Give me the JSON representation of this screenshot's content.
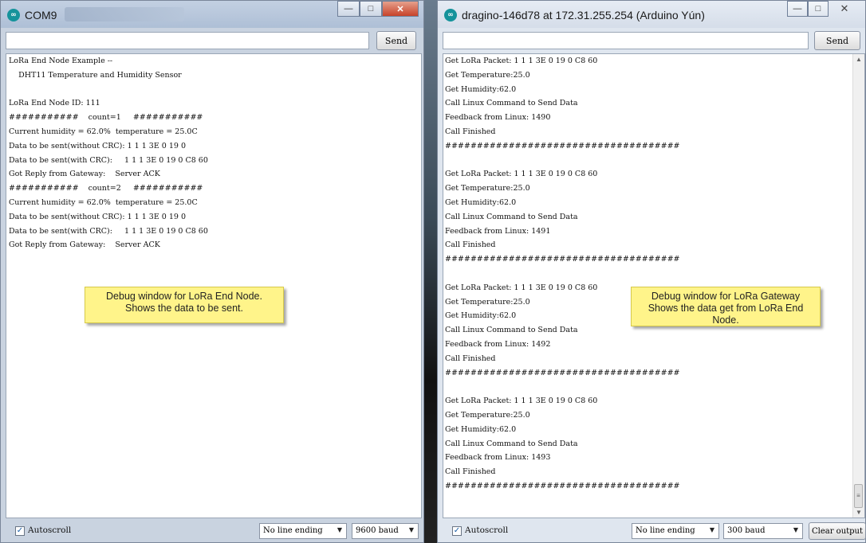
{
  "left_window": {
    "title": "COM9",
    "send_label": "Send",
    "input_value": "",
    "output_lines": [
      "LoRa End Node Example --",
      "    DHT11 Temperature and Humidity Sensor",
      "",
      "LoRa End Node ID: 111",
      "###########    count=1     ###########",
      "Current humidity = 62.0%  temperature = 25.0C",
      "Data to be sent(without CRC): 1 1 1 3E 0 19 0",
      "Data to be sent(with CRC):     1 1 1 3E 0 19 0 C8 60",
      "Got Reply from Gateway:    Server ACK",
      "###########    count=2     ###########",
      "Current humidity = 62.0%  temperature = 25.0C",
      "Data to be sent(without CRC): 1 1 1 3E 0 19 0",
      "Data to be sent(with CRC):     1 1 1 3E 0 19 0 C8 60",
      "Got Reply from Gateway:    Server ACK"
    ],
    "callout": [
      "Debug window for LoRa End Node.",
      "Shows the data to be sent."
    ],
    "autoscroll_label": "Autoscroll",
    "autoscroll_checked": true,
    "line_ending": "No line ending",
    "baud": "9600 baud"
  },
  "right_window": {
    "title": "dragino-146d78 at 172.31.255.254 (Arduino Yún)",
    "send_label": "Send",
    "input_value": "",
    "output_lines": [
      "Get LoRa Packet: 1 1 1 3E 0 19 0 C8 60",
      "Get Temperature:25.0",
      "Get Humidity:62.0",
      "Call Linux Command to Send Data",
      "Feedback from Linux: 1490",
      "Call Finished",
      "#####################################",
      "",
      "Get LoRa Packet: 1 1 1 3E 0 19 0 C8 60",
      "Get Temperature:25.0",
      "Get Humidity:62.0",
      "Call Linux Command to Send Data",
      "Feedback from Linux: 1491",
      "Call Finished",
      "#####################################",
      "",
      "Get LoRa Packet: 1 1 1 3E 0 19 0 C8 60",
      "Get Temperature:25.0",
      "Get Humidity:62.0",
      "Call Linux Command to Send Data",
      "Feedback from Linux: 1492",
      "Call Finished",
      "#####################################",
      "",
      "Get LoRa Packet: 1 1 1 3E 0 19 0 C8 60",
      "Get Temperature:25.0",
      "Get Humidity:62.0",
      "Call Linux Command to Send Data",
      "Feedback from Linux: 1493",
      "Call Finished",
      "#####################################"
    ],
    "callout": [
      "Debug window for LoRa Gateway",
      "Shows the data get from LoRa End",
      "Node."
    ],
    "autoscroll_label": "Autoscroll",
    "autoscroll_checked": true,
    "line_ending": "No line ending",
    "baud": "300 baud",
    "clear_label": "Clear output"
  },
  "icons": {
    "app": "arduino-icon",
    "minimize": "minimize-icon",
    "maximize": "maximize-icon",
    "close": "close-icon"
  },
  "colors": {
    "callout_bg": "#fff48a",
    "arduino_teal": "#15939b",
    "close_red": "#c7432a"
  }
}
